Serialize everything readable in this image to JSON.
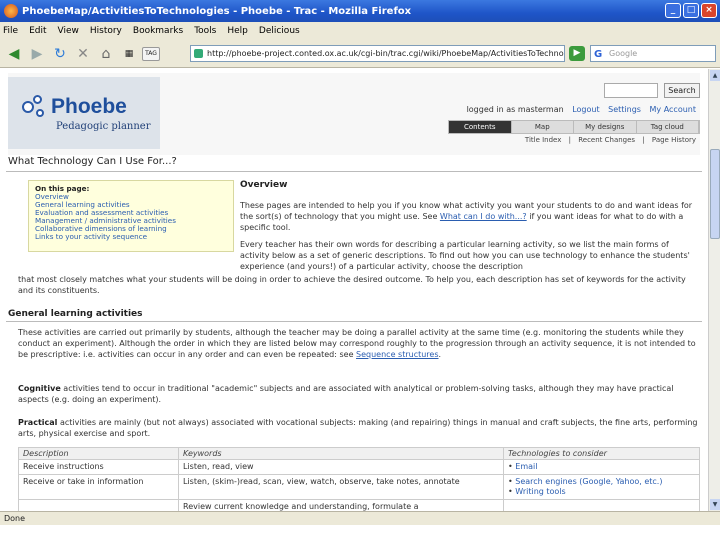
{
  "window": {
    "title": "PhoebeMap/ActivitiesToTechnologies - Phoebe - Trac - Mozilla Firefox",
    "minimize": "_",
    "maximize": "□",
    "close": "×"
  },
  "menu": [
    "File",
    "Edit",
    "View",
    "History",
    "Bookmarks",
    "Tools",
    "Help",
    "Delicious"
  ],
  "toolbar": {
    "url": "http://phoebe-project.conted.ox.ac.uk/cgi-bin/trac.cgi/wiki/PhoebeMap/ActivitiesToTechnologies",
    "search_placeholder": "Google",
    "search_engine_glyph": "G",
    "go_glyph": "▶",
    "tag_label": "TAG"
  },
  "site": {
    "logo_title": "Phoebe",
    "logo_subtitle": "Pedagogic planner",
    "search_button": "Search",
    "user_text": "logged in as masterman",
    "logout": "Logout",
    "settings": "Settings",
    "my_account": "My Account",
    "tabs": [
      "Contents",
      "Map",
      "My designs",
      "Tag cloud"
    ],
    "active_tab": "Contents",
    "subnav": [
      "Title Index",
      "Recent Changes",
      "Page History"
    ]
  },
  "page": {
    "heading": "What Technology Can I Use For...?",
    "toc": {
      "title": "On this page:",
      "items": [
        "Overview",
        "General learning activities",
        "Evaluation and assessment activities",
        "Management / administrative activities",
        "Collaborative dimensions of learning",
        "Links to your activity sequence"
      ]
    },
    "overview": {
      "heading": "Overview",
      "p1_a": "These pages are intended to help you if you know what activity you want your students to do and want ideas for the sort(s) of technology that you might use. See ",
      "p1_link": "What can I do with...?",
      "p1_b": " if you want ideas for what to do with a specific tool.",
      "p2": "Every teacher has their own words for describing a particular learning activity, so we list the main forms of activity below as a set of generic descriptions. To find out how you can use technology to enhance the students' experience (and yours!) of a particular activity, choose the description"
    },
    "p2_cont": "that most closely matches what your students will be doing in order to achieve the desired outcome. To help you, each description has set of keywords for the activity and its constituents.",
    "general_heading": "General learning activities",
    "general_p_a": "These activities are carried out primarily by students, although the teacher may be doing a parallel activity at the same time (e.g. monitoring the students while they conduct an experiment). Although the order in which they are listed below may correspond roughly to the progression through an activity sequence, it is not intended to be prescriptive: i.e. activities can occur in any order and can even be repeated: see ",
    "general_p_link": "Sequence structures",
    "general_p_b": ".",
    "cognitive_label": "Cognitive",
    "cognitive_text": " activities tend to occur in traditional \"academic\" subjects and are associated with analytical or problem-solving tasks, although they may have practical aspects (e.g. doing an experiment).",
    "practical_label": "Practical",
    "practical_text": " activities are mainly (but not always) associated with vocational subjects: making (and repairing) things in manual and craft subjects, the fine arts, performing arts, physical exercise and sport.",
    "table": {
      "headers": [
        "Description",
        "Keywords",
        "Technologies to consider"
      ],
      "rows": [
        {
          "description": "Receive instructions",
          "keywords": "Listen, read, view",
          "tech": [
            "Email"
          ]
        },
        {
          "description": "Receive or take in information",
          "keywords": "Listen, (skim-)read, scan, view, watch, observe, take notes, annotate",
          "tech": [
            "Search engines (Google, Yahoo, etc.)",
            "Writing tools"
          ]
        },
        {
          "description": "",
          "keywords": "Review current knowledge and understanding, formulate a",
          "tech": []
        }
      ]
    }
  },
  "status": {
    "text": "Done"
  }
}
